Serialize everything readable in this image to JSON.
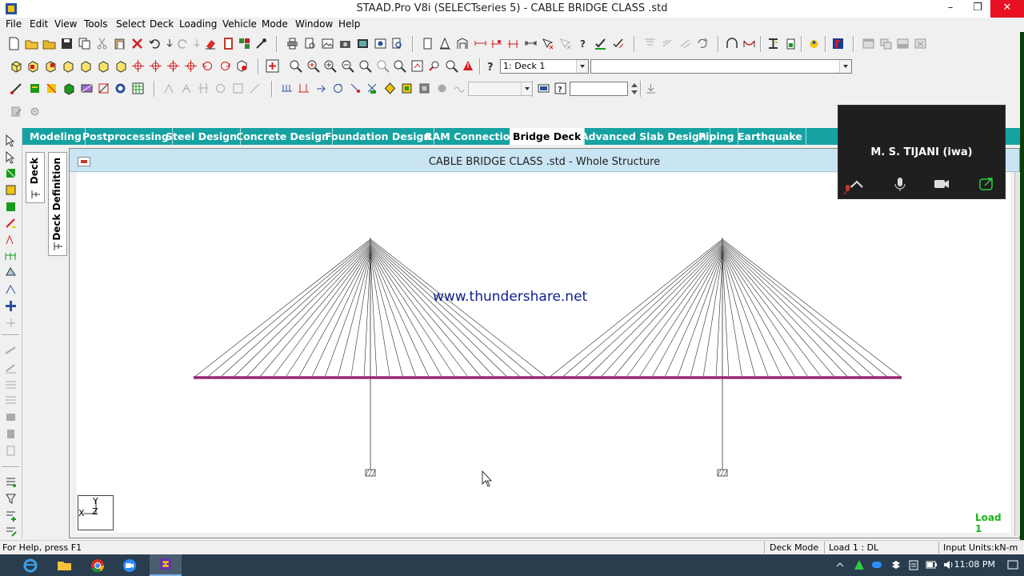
{
  "window": {
    "title": "STAAD.Pro V8i (SELECTseries 5) - CABLE BRIDGE CLASS .std",
    "minimize": "–",
    "maximize": "❐",
    "close": "✕"
  },
  "menu": [
    "File",
    "Edit",
    "View",
    "Tools",
    "Select",
    "Deck",
    "Loading",
    "Vehicle",
    "Mode",
    "Window",
    "Help"
  ],
  "toolbar": {
    "deck_combo_value": "1: Deck 1",
    "secondary_combo_value": "",
    "disabled_combo_value": "",
    "numeric_field_value": ""
  },
  "page_tabs": [
    "Modeling",
    "Postprocessing",
    "Steel Design",
    "Concrete Design",
    "Foundation Design",
    "RAM Connection",
    "Bridge Deck",
    "Advanced Slab Design",
    "Piping",
    "Earthquake"
  ],
  "active_page_tab": "Bridge Deck",
  "vertical_tabs": [
    "Deck",
    "Deck Definition"
  ],
  "child_window": {
    "title": "CABLE BRIDGE CLASS .std - Whole Structure"
  },
  "viewport": {
    "watermark": "www.thundershare.net",
    "load_label": "Load 1",
    "axis_y": "Y",
    "axis_x": "X",
    "axis_z": "Z"
  },
  "zoom_overlay": {
    "participant_name": "M. S. TIJANI (iwa)"
  },
  "status_bar": {
    "help": "For Help, press F1",
    "mode": "Deck Mode",
    "load": "Load 1 : DL",
    "units_label": "Input Units:",
    "units_value": "kN-m"
  },
  "taskbar": {
    "clock": "11:08 PM"
  },
  "colors": {
    "tab_bar": "#17a2a2",
    "deck_line": "#c2185b",
    "deck_line_inner": "#3949ab",
    "load_label": "#1bb31b",
    "watermark": "#0b1f8a",
    "taskbar": "#2a3d4f"
  }
}
